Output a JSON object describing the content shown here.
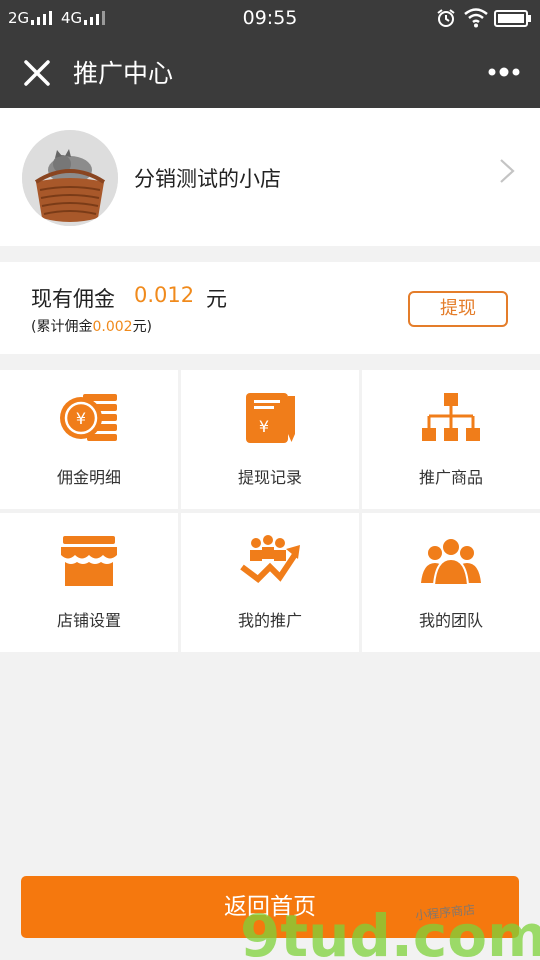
{
  "status_bar": {
    "net1": "2G",
    "net2": "4G",
    "time": "09:55"
  },
  "header": {
    "title": "推广中心"
  },
  "store": {
    "name": "分销测试的小店"
  },
  "commission": {
    "label": "现有佣金",
    "amount": "0.012",
    "unit": "元",
    "total_prefix": "(累计佣金",
    "total_value": "0.002",
    "total_suffix": "元)",
    "withdraw_label": "提现"
  },
  "menu": [
    {
      "label": "佣金明细",
      "icon": "coins-icon"
    },
    {
      "label": "提现记录",
      "icon": "receipt-icon"
    },
    {
      "label": "推广商品",
      "icon": "hierarchy-icon"
    },
    {
      "label": "店铺设置",
      "icon": "storefront-icon"
    },
    {
      "label": "我的推广",
      "icon": "growth-icon"
    },
    {
      "label": "我的团队",
      "icon": "team-icon"
    }
  ],
  "footer": {
    "home_label": "返回首页"
  },
  "watermark": {
    "text": "9tud.com",
    "tagline": "小程序商店"
  },
  "colors": {
    "accent": "#f5780e",
    "icon": "#f07d1a",
    "nav": "#3b3b3b"
  }
}
